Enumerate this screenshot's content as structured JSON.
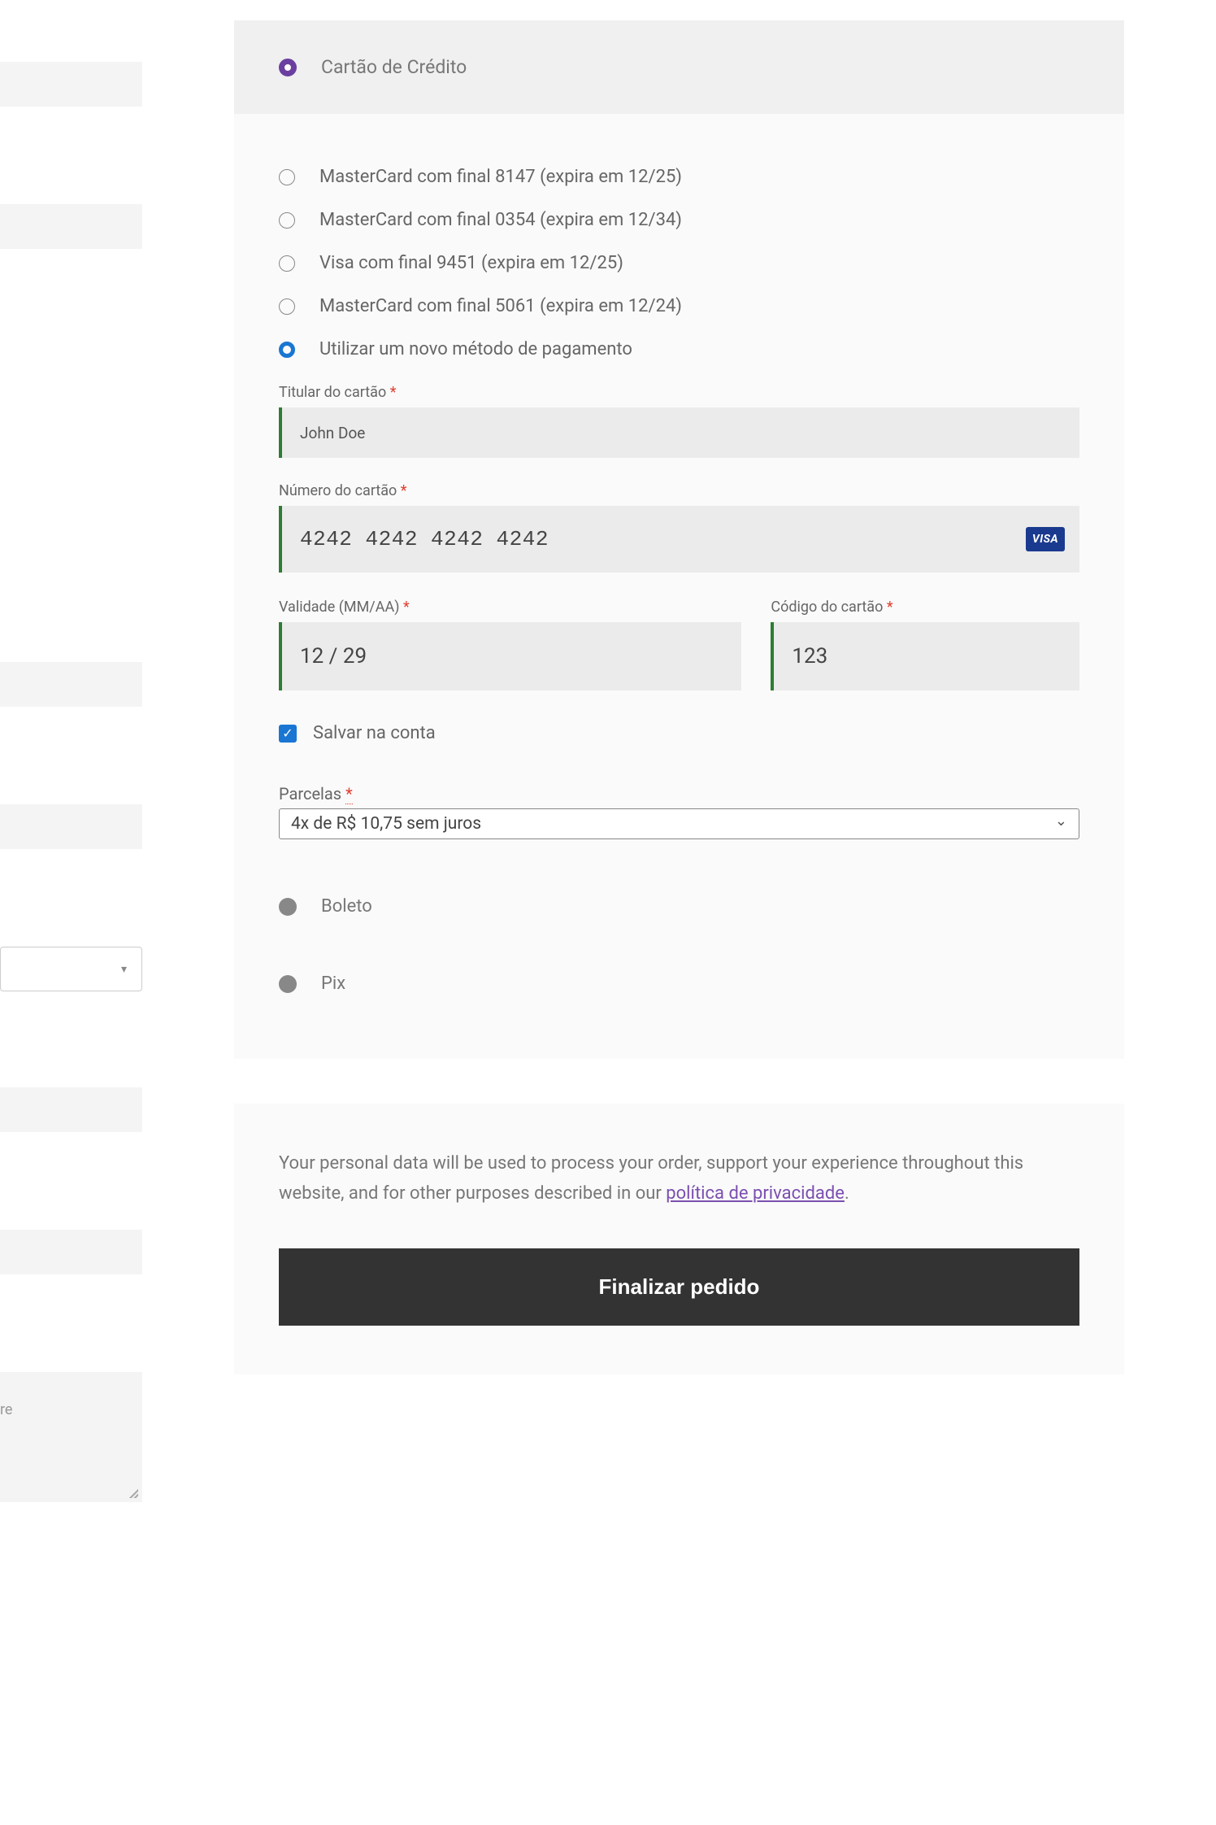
{
  "left": {
    "textareaPlaceholder": "re"
  },
  "payment": {
    "creditCardLabel": "Cartão de Crédito",
    "savedCards": [
      "MasterCard com final 8147 (expira em 12/25)",
      "MasterCard com final 0354 (expira em 12/34)",
      "Visa com final 9451 (expira em 12/25)",
      "MasterCard com final 5061 (expira em 12/24)"
    ],
    "newMethodLabel": "Utilizar um novo método de pagamento",
    "cardholder": {
      "label": "Titular do cartão",
      "value": "John Doe"
    },
    "cardNumber": {
      "label": "Número do cartão",
      "value": "4242 4242 4242 4242",
      "brand": "VISA"
    },
    "expiry": {
      "label": "Validade (MM/AA)",
      "value": "12 / 29"
    },
    "cvc": {
      "label": "Código do cartão",
      "value": "123"
    },
    "saveLabel": "Salvar na conta",
    "installments": {
      "label": "Parcelas",
      "value": "4x de R$ 10,75 sem juros"
    },
    "boletoLabel": "Boleto",
    "pixLabel": "Pix"
  },
  "footer": {
    "privacyText": "Your personal data will be used to process your order, support your experience throughout this website, and for other purposes described in our ",
    "privacyLink": "política de privacidade",
    "period": ".",
    "submitLabel": "Finalizar pedido"
  }
}
